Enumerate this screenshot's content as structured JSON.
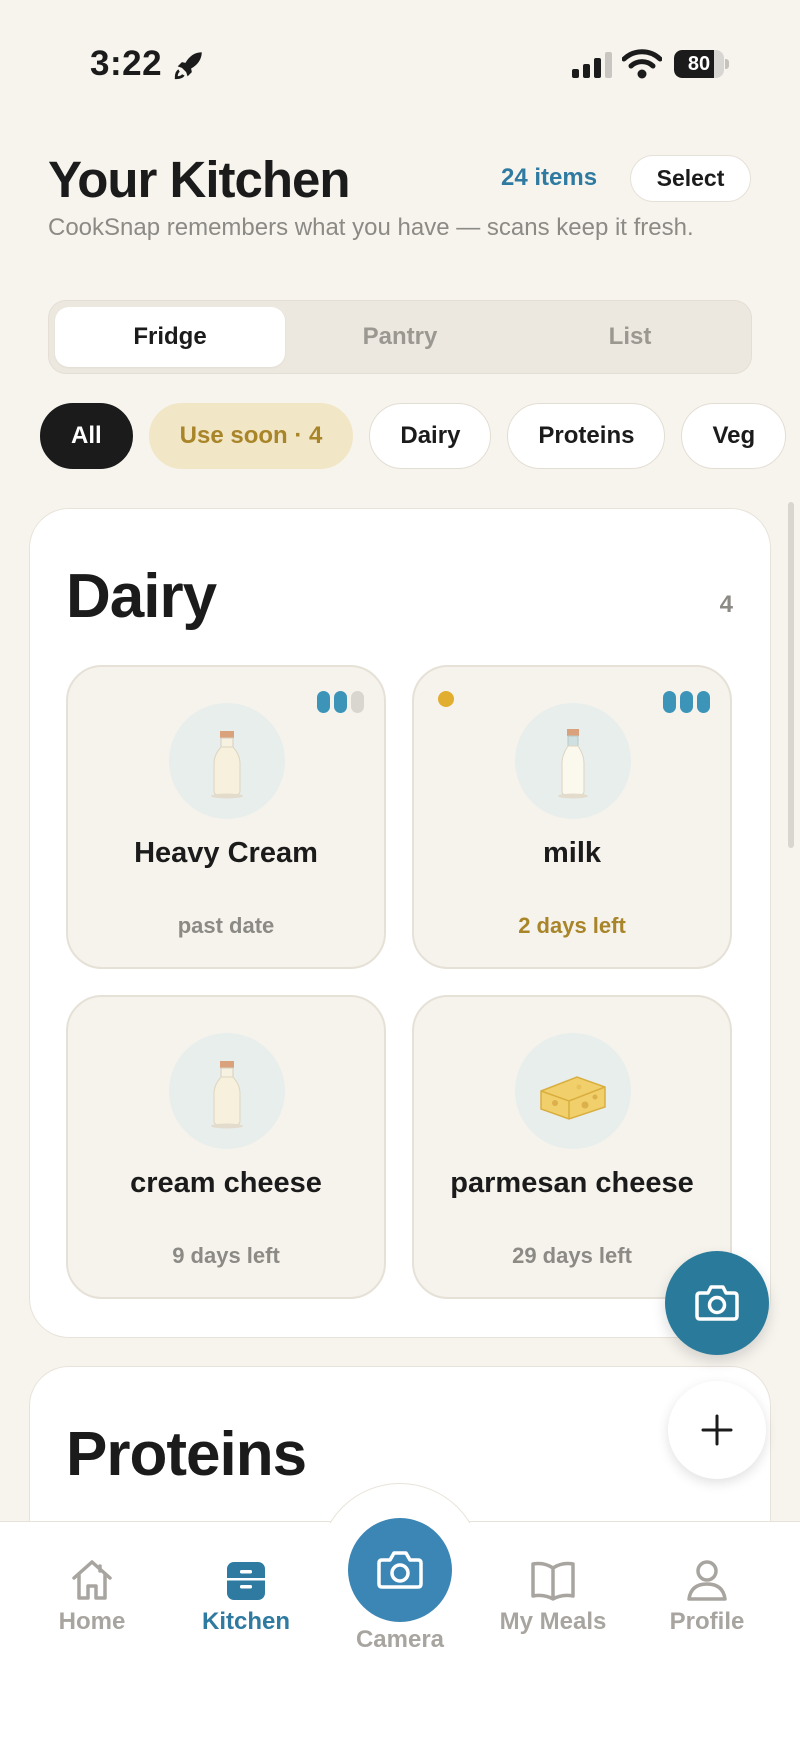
{
  "status_bar": {
    "time": "3:22",
    "battery": "80",
    "battery_level": 0.8
  },
  "header": {
    "title": "Your Kitchen",
    "item_count": "24 items",
    "select_label": "Select",
    "subtitle": "CookSnap remembers what you have — scans keep it fresh."
  },
  "segments": [
    {
      "label": "Fridge",
      "active": true
    },
    {
      "label": "Pantry",
      "active": false
    },
    {
      "label": "List",
      "active": false
    }
  ],
  "filters": [
    {
      "label": "All",
      "style": "dark"
    },
    {
      "label": "Use soon · 4",
      "style": "warn"
    },
    {
      "label": "Dairy",
      "style": "plain"
    },
    {
      "label": "Proteins",
      "style": "plain"
    },
    {
      "label": "Veg",
      "style": "plain"
    }
  ],
  "dairy": {
    "title": "Dairy",
    "count": "4",
    "items": [
      {
        "name": "Heavy Cream",
        "expiry": "past date",
        "freshness": 2,
        "icon": "milk-bottle-icon"
      },
      {
        "name": "milk",
        "expiry": "2 days left",
        "freshness": 3,
        "use_soon": true,
        "icon": "milk-bottle-icon"
      },
      {
        "name": "cream cheese",
        "expiry": "9 days left",
        "freshness": 0,
        "icon": "milk-bottle-icon"
      },
      {
        "name": "parmesan cheese",
        "expiry": "29 days left",
        "freshness": 0,
        "icon": "cheese-icon"
      }
    ]
  },
  "proteins": {
    "title": "Proteins"
  },
  "tab_bar": {
    "home": "Home",
    "kitchen": "Kitchen",
    "camera": "Camera",
    "my_meals": "My Meals",
    "profile": "Profile",
    "active": "kitchen"
  },
  "colors": {
    "accent": "#2e7aa0",
    "warn": "#a9852a",
    "background": "#f7f4ee",
    "freshness_bar": "#3c94b8"
  }
}
